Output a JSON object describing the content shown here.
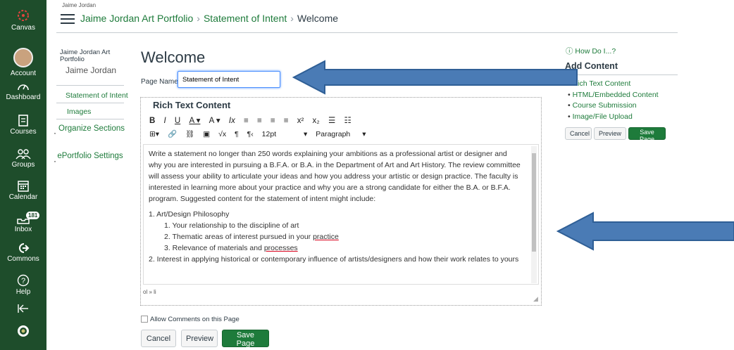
{
  "global_nav": {
    "canvas": "Canvas",
    "account": "Account",
    "dashboard": "Dashboard",
    "courses": "Courses",
    "groups": "Groups",
    "calendar": "Calendar",
    "inbox": "Inbox",
    "inbox_badge": "181",
    "commons": "Commons",
    "help": "Help"
  },
  "header": {
    "small_name": "Jaime Jordan",
    "breadcrumb": [
      "Jaime Jordan Art Portfolio",
      "Statement of Intent",
      "Welcome"
    ]
  },
  "sidebar": {
    "title": "Jaime Jordan Art Portfolio",
    "subtitle": "Jaime Jordan",
    "items": [
      "Statement of Intent",
      "Images"
    ],
    "links": [
      "Organize Sections",
      "ePortfolio Settings"
    ]
  },
  "main": {
    "heading": "Welcome",
    "page_name_label": "Page Name:",
    "page_name_value": "Statement of Intent",
    "editor_title": "Rich Text Content",
    "toolbar_row1": [
      "B",
      "I",
      "U",
      "A ▾",
      "A ▾",
      "Ix",
      "≡",
      "≡",
      "≡",
      "≡",
      "x²",
      "x₂",
      "☰",
      "☷"
    ],
    "toolbar_row2": [
      "⊞▾",
      "🔗",
      "⛓",
      "▣",
      "√x",
      "¶",
      "¶‹",
      "12pt",
      "▾",
      "Paragraph",
      "▾"
    ],
    "paragraph": "Write a statement no longer than 250 words explaining your ambitions as a professional artist or designer and why you are interested in pursuing a B.F.A. or B.A. in the Department of Art and Art History. The review committee will assess your ability to articulate your ideas and how you address your artistic or design practice. The faculty is interested in learning more about your practice and why you are a strong candidate for either the B.A. or B.F.A. program. Suggested content for the statement of intent might include:",
    "list": {
      "item1": "1. Art/Design Philosophy",
      "sub1": "1. Your relationship to the discipline of art",
      "sub2_prefix": "2. Thematic areas of interest pursued in your ",
      "sub2_word": "practice",
      "sub3_prefix": "3. Relevance of materials and ",
      "sub3_word": "processes",
      "item2": "2. Interest in applying historical or contemporary influence of artists/designers and how their work relates to yours"
    },
    "status_path": "ol » li",
    "allow_comments": "Allow Comments on this Page",
    "cancel": "Cancel",
    "preview": "Preview",
    "save": "Save Page"
  },
  "right_panel": {
    "how_do_i": "How Do I...?",
    "add_content": "Add Content",
    "items": [
      "Rich Text Content",
      "HTML/Embedded Content",
      "Course Submission",
      "Image/File Upload"
    ],
    "cancel": "Cancel",
    "preview": "Preview",
    "save": "Save Page"
  },
  "colors": {
    "nav_bg": "#1e4d2b",
    "link": "#1e7b3b",
    "arrow": "#4a7bb5"
  }
}
